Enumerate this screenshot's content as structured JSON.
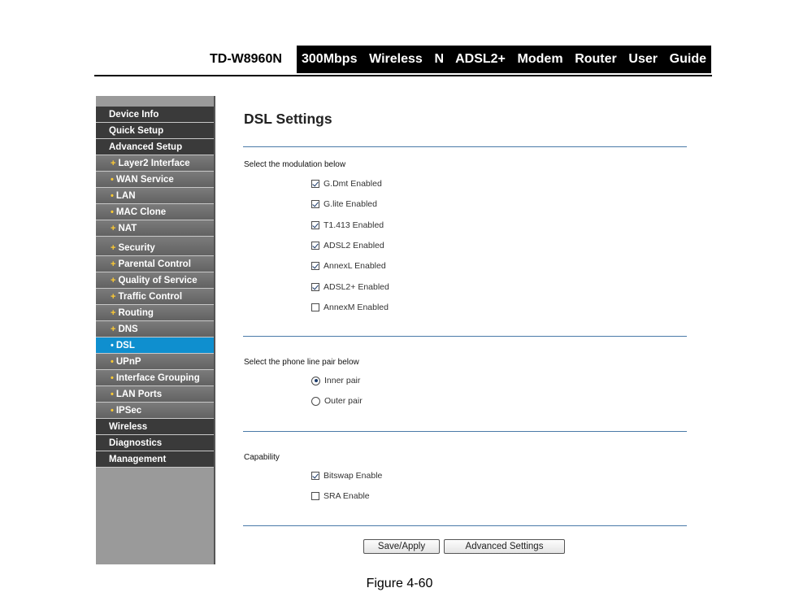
{
  "header": {
    "model": "TD-W8960N",
    "guide_title": "300Mbps Wireless N ADSL2+ Modem Router User Guide"
  },
  "sidebar": {
    "items": [
      {
        "label": "Device Info",
        "level": "main"
      },
      {
        "label": "Quick Setup",
        "level": "main"
      },
      {
        "label": "Advanced Setup",
        "level": "main"
      },
      {
        "label": "Layer2 Interface",
        "level": "sub",
        "bullet": "+"
      },
      {
        "label": "WAN Service",
        "level": "sub",
        "bullet": "•"
      },
      {
        "label": "LAN",
        "level": "sub",
        "bullet": "•"
      },
      {
        "label": "MAC Clone",
        "level": "sub",
        "bullet": "•"
      },
      {
        "label": "NAT",
        "level": "sub",
        "bullet": "+"
      },
      {
        "label": "Security",
        "level": "sub",
        "bullet": "+"
      },
      {
        "label": "Parental Control",
        "level": "sub",
        "bullet": "+"
      },
      {
        "label": "Quality of Service",
        "level": "sub",
        "bullet": "+"
      },
      {
        "label": "Traffic Control",
        "level": "sub",
        "bullet": "+"
      },
      {
        "label": "Routing",
        "level": "sub",
        "bullet": "+"
      },
      {
        "label": "DNS",
        "level": "sub",
        "bullet": "+"
      },
      {
        "label": "DSL",
        "level": "sub",
        "bullet": "•",
        "active": true
      },
      {
        "label": "UPnP",
        "level": "sub",
        "bullet": "•"
      },
      {
        "label": "Interface Grouping",
        "level": "sub",
        "bullet": "•"
      },
      {
        "label": "LAN Ports",
        "level": "sub",
        "bullet": "•"
      },
      {
        "label": "IPSec",
        "level": "sub",
        "bullet": "•"
      },
      {
        "label": "Wireless",
        "level": "main"
      },
      {
        "label": "Diagnostics",
        "level": "main"
      },
      {
        "label": "Management",
        "level": "main"
      }
    ]
  },
  "main": {
    "title": "DSL Settings",
    "modulation": {
      "label": "Select the modulation below",
      "options": [
        {
          "label": "G.Dmt Enabled",
          "checked": true
        },
        {
          "label": "G.lite Enabled",
          "checked": true
        },
        {
          "label": "T1.413 Enabled",
          "checked": true
        },
        {
          "label": "ADSL2 Enabled",
          "checked": true
        },
        {
          "label": "AnnexL Enabled",
          "checked": true
        },
        {
          "label": "ADSL2+ Enabled",
          "checked": true
        },
        {
          "label": "AnnexM Enabled",
          "checked": false
        }
      ]
    },
    "phone_pair": {
      "label": "Select the phone line pair below",
      "options": [
        {
          "label": "Inner pair",
          "selected": true
        },
        {
          "label": "Outer pair",
          "selected": false
        }
      ]
    },
    "capability": {
      "label": "Capability",
      "options": [
        {
          "label": "Bitswap Enable",
          "checked": true
        },
        {
          "label": "SRA Enable",
          "checked": false
        }
      ]
    },
    "buttons": {
      "save": "Save/Apply",
      "advanced": "Advanced Settings"
    }
  },
  "caption": "Figure 4-60"
}
